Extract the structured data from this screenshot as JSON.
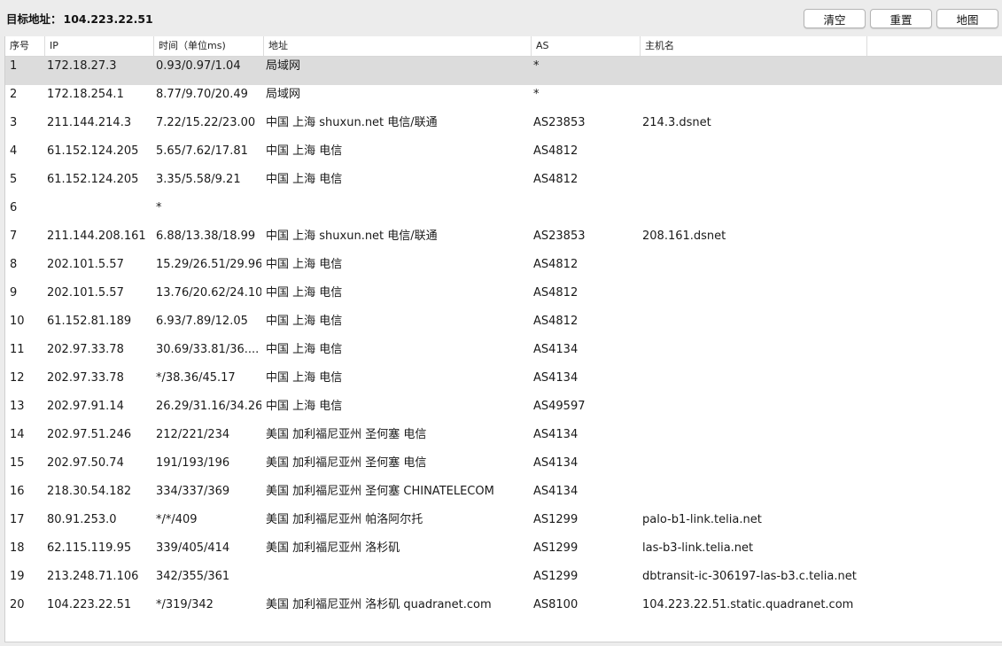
{
  "header": {
    "target_label": "目标地址：",
    "target_value": "104.223.22.51",
    "buttons": {
      "clear": "清空",
      "reset": "重置",
      "map": "地图"
    }
  },
  "table": {
    "columns": [
      "序号",
      "IP",
      "时间（单位ms)",
      "地址",
      "AS",
      "主机名"
    ],
    "rows": [
      [
        "1",
        "172.18.27.3",
        "0.93/0.97/1.04",
        "局域网",
        "*",
        ""
      ],
      [
        "2",
        "172.18.254.1",
        "8.77/9.70/20.49",
        "局域网",
        "*",
        ""
      ],
      [
        "3",
        "211.144.214.3",
        "7.22/15.22/23.00",
        "中国 上海 shuxun.net 电信/联通",
        "AS23853",
        "214.3.dsnet"
      ],
      [
        "4",
        "61.152.124.205",
        "5.65/7.62/17.81",
        "中国 上海  电信",
        "AS4812",
        ""
      ],
      [
        "5",
        "61.152.124.205",
        "3.35/5.58/9.21",
        "中国 上海  电信",
        "AS4812",
        ""
      ],
      [
        "6",
        "",
        "*",
        "",
        "",
        ""
      ],
      [
        "7",
        "211.144.208.161",
        "6.88/13.38/18.99",
        "中国 上海 shuxun.net 电信/联通",
        "AS23853",
        "208.161.dsnet"
      ],
      [
        "8",
        "202.101.5.57",
        "15.29/26.51/29.96",
        "中国 上海  电信",
        "AS4812",
        ""
      ],
      [
        "9",
        "202.101.5.57",
        "13.76/20.62/24.10",
        "中国 上海  电信",
        "AS4812",
        ""
      ],
      [
        "10",
        "61.152.81.189",
        "6.93/7.89/12.05",
        "中国 上海  电信",
        "AS4812",
        ""
      ],
      [
        "11",
        "202.97.33.78",
        "30.69/33.81/36....",
        "中国 上海  电信",
        "AS4134",
        ""
      ],
      [
        "12",
        "202.97.33.78",
        "*/38.36/45.17",
        "中国 上海  电信",
        "AS4134",
        ""
      ],
      [
        "13",
        "202.97.91.14",
        "26.29/31.16/34.26",
        "中国 上海  电信",
        "AS49597",
        ""
      ],
      [
        "14",
        "202.97.51.246",
        "212/221/234",
        "美国 加利福尼亚州 圣何塞  电信",
        "AS4134",
        ""
      ],
      [
        "15",
        "202.97.50.74",
        "191/193/196",
        "美国 加利福尼亚州 圣何塞  电信",
        "AS4134",
        ""
      ],
      [
        "16",
        "218.30.54.182",
        "334/337/369",
        "美国 加利福尼亚州 圣何塞  CHINATELECOM",
        "AS4134",
        ""
      ],
      [
        "17",
        "80.91.253.0",
        "*/*/409",
        "美国 加利福尼亚州 帕洛阿尔托",
        "AS1299",
        "palo-b1-link.telia.net"
      ],
      [
        "18",
        "62.115.119.95",
        "339/405/414",
        "美国 加利福尼亚州 洛杉矶",
        "AS1299",
        "las-b3-link.telia.net"
      ],
      [
        "19",
        "213.248.71.106",
        "342/355/361",
        "",
        "AS1299",
        "dbtransit-ic-306197-las-b3.c.telia.net"
      ],
      [
        "20",
        "104.223.22.51",
        "*/319/342",
        "美国 加利福尼亚州 洛杉矶  quadranet.com",
        "AS8100",
        "104.223.22.51.static.quadranet.com"
      ]
    ],
    "selected_row": 1
  }
}
